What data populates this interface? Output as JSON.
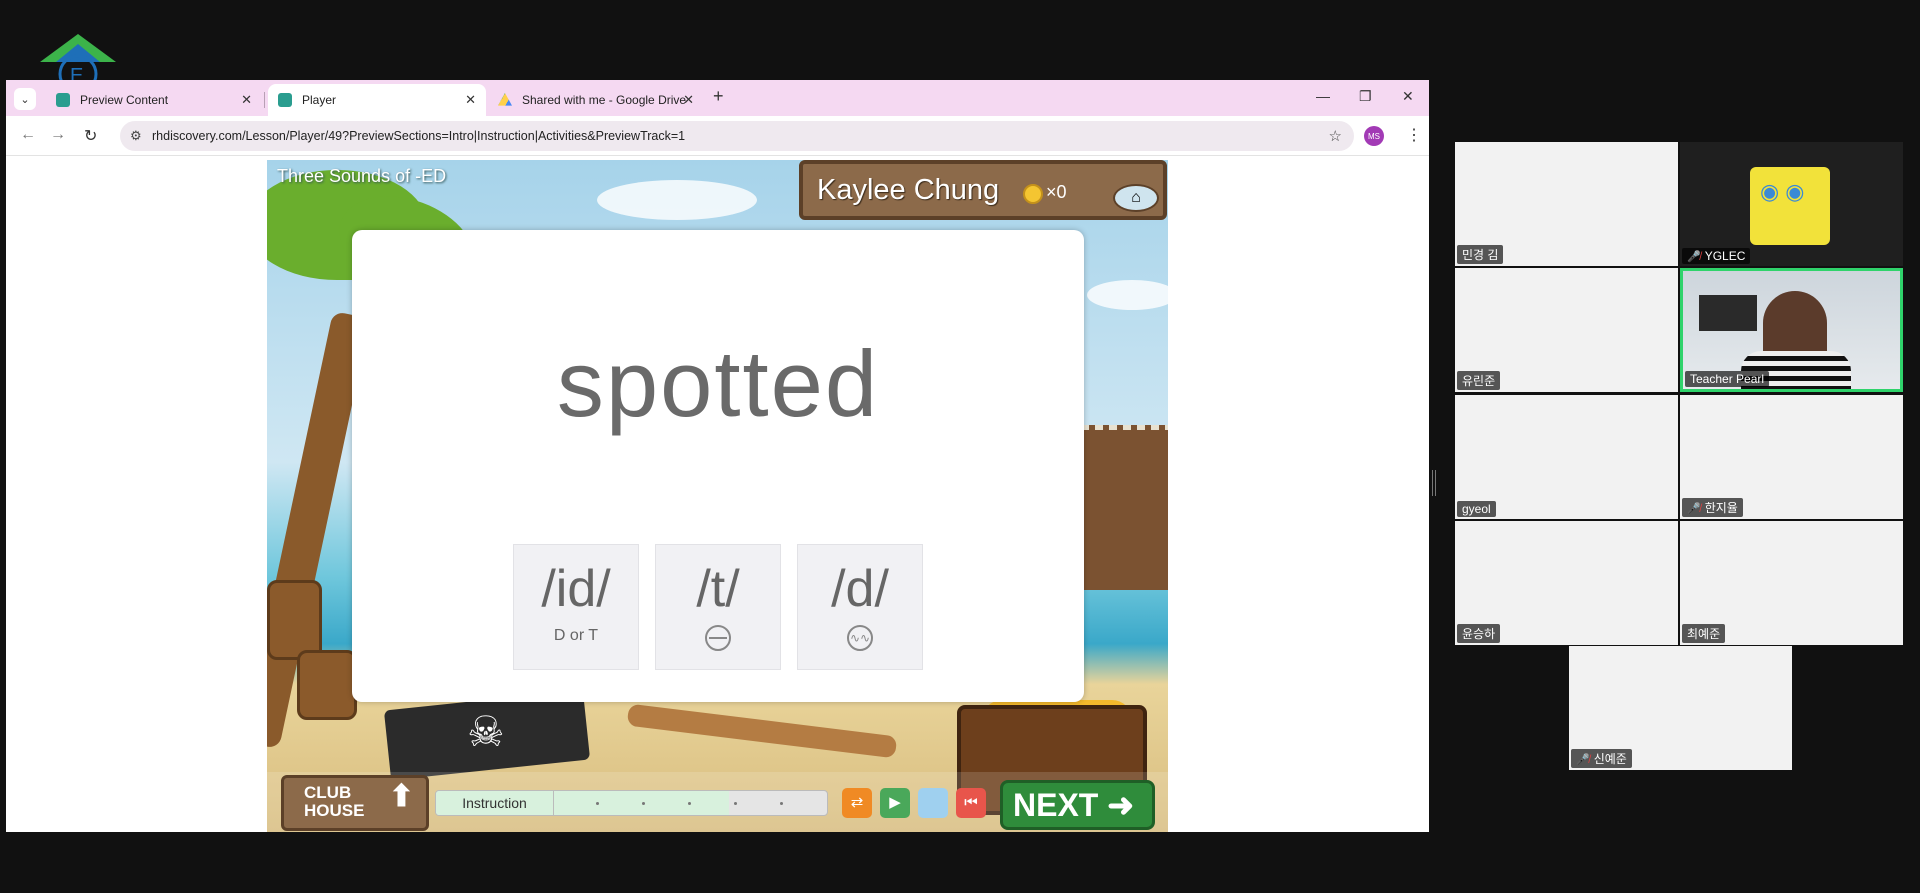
{
  "browser": {
    "tabs": [
      {
        "title": "Preview Content",
        "active": false
      },
      {
        "title": "Player",
        "active": true
      },
      {
        "title": "Shared with me - Google Drive",
        "active": false
      }
    ],
    "url": "rhdiscovery.com/Lesson/Player/49?PreviewSections=Intro|Instruction|Activities&PreviewTrack=1",
    "profile_initials": "MS"
  },
  "game": {
    "lesson_title": "Three Sounds of -ED",
    "student_name": "Kaylee Chung",
    "coin_count": "×0",
    "word": "spotted",
    "choices": [
      {
        "sound": "/id/",
        "hint": "D or T"
      },
      {
        "sound": "/t/",
        "hint_icon": "unvoiced-icon"
      },
      {
        "sound": "/d/",
        "hint_icon": "voiced-wave-icon"
      }
    ],
    "clubhouse_line1": "CLUB",
    "clubhouse_line2": "HOUSE",
    "progress_label": "Instruction",
    "progress_fraction": 0.75,
    "next_label": "NEXT"
  },
  "participants": [
    {
      "name": "민경 김",
      "muted": false
    },
    {
      "name": "YGLEC",
      "muted": true
    },
    {
      "name": "유린준",
      "muted": false
    },
    {
      "name": "Teacher Pearl",
      "muted": false,
      "active_speaker": true
    },
    {
      "name": "gyeol",
      "muted": false
    },
    {
      "name": "한지율",
      "muted": true
    },
    {
      "name": "윤승하",
      "muted": false
    },
    {
      "name": "최예준",
      "muted": false
    },
    {
      "name": "신예준",
      "muted": true
    }
  ],
  "colors": {
    "tab_strip": "#f5d9f2",
    "active_speaker_border": "#2fd36b",
    "next_button": "#2f8c3b"
  }
}
